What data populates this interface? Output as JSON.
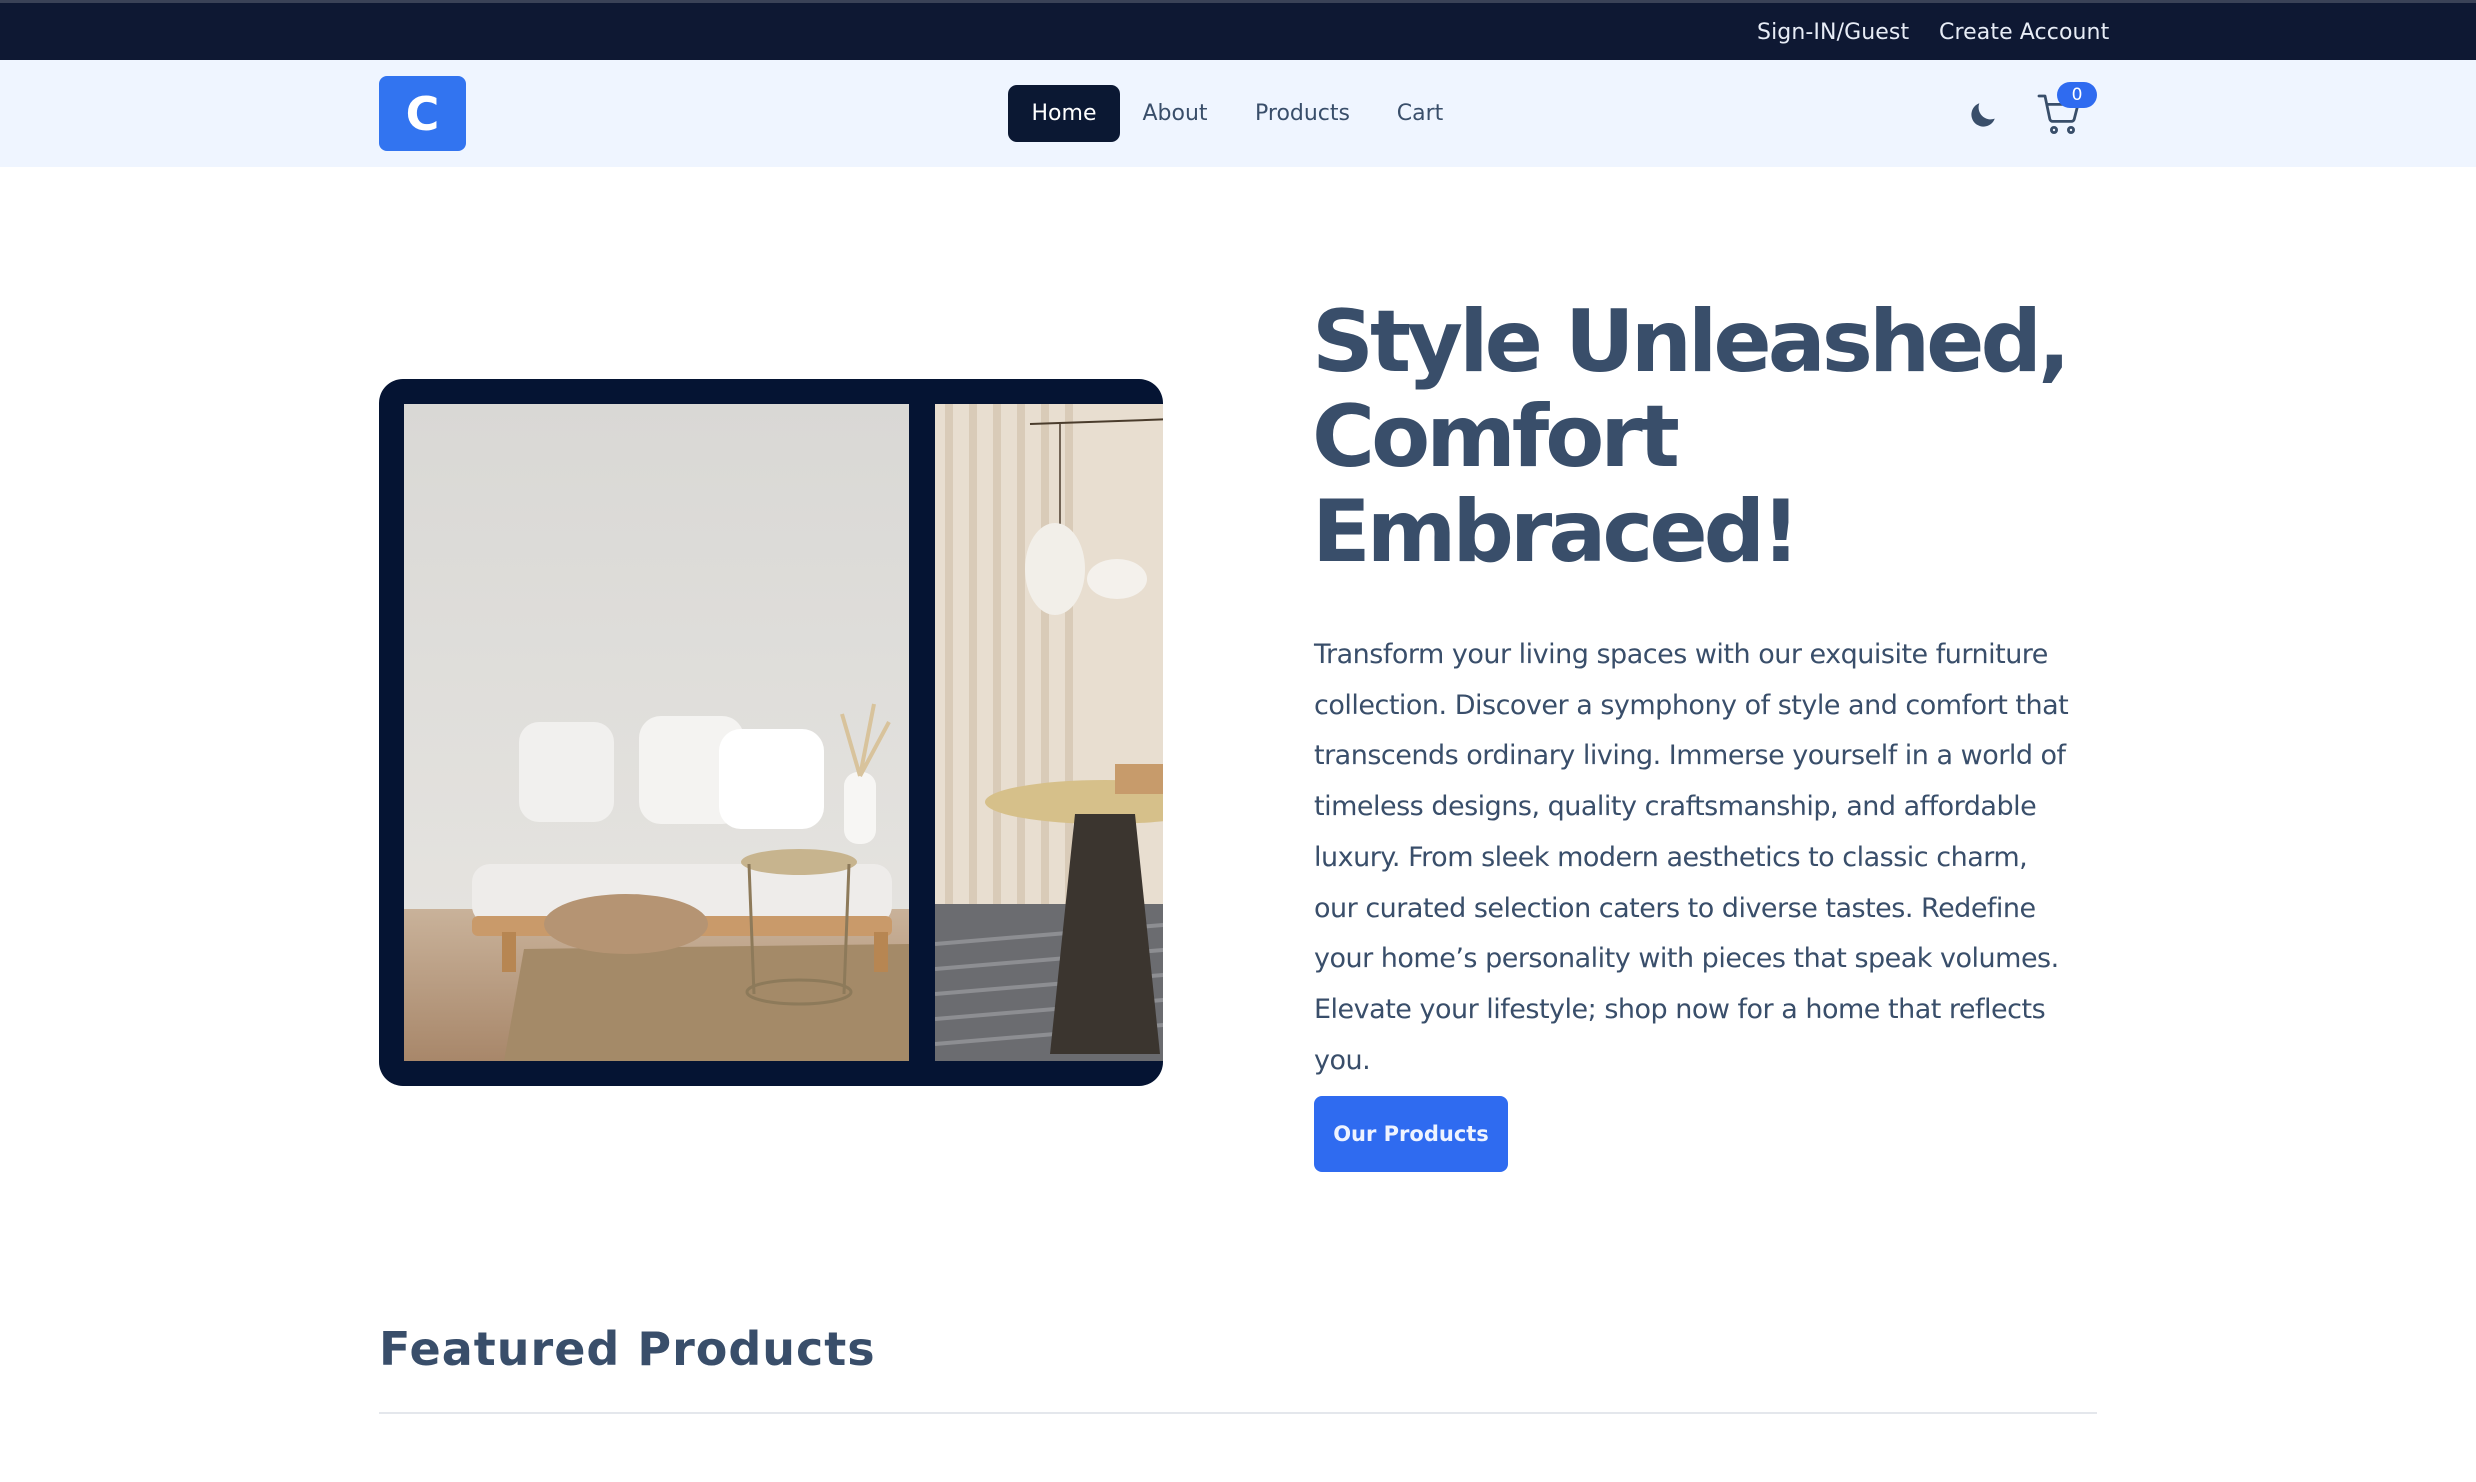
{
  "topbar": {
    "sign_in": "Sign-IN/Guest",
    "create_account": "Create Account"
  },
  "navbar": {
    "logo_letter": "C",
    "links": [
      {
        "label": "Home",
        "active": true
      },
      {
        "label": "About",
        "active": false
      },
      {
        "label": "Products",
        "active": false
      },
      {
        "label": "Cart",
        "active": false
      }
    ],
    "theme_icon": "moon-icon",
    "cart_icon": "cart-icon",
    "cart_count": "0"
  },
  "hero": {
    "title": "Style Unleashed, Comfort Embraced!",
    "description": "Transform your living spaces with our exquisite furniture collection. Discover a symphony of style and comfort that transcends ordinary living. Immerse yourself in a world of timeless designs, quality craftsmanship, and affordable luxury. From sleek modern aesthetics to classic charm, our curated selection caters to diverse tastes. Redefine your home’s personality with pieces that speak volumes. Elevate your lifestyle; shop now for a home that reflects you.",
    "cta_label": "Our Products"
  },
  "featured": {
    "title": "Featured Products"
  },
  "colors": {
    "topbar_bg": "#0e1833",
    "navbar_bg": "#eff5ff",
    "accent": "#2f6bf0",
    "dark": "#0b1833",
    "text": "#394e6a"
  }
}
